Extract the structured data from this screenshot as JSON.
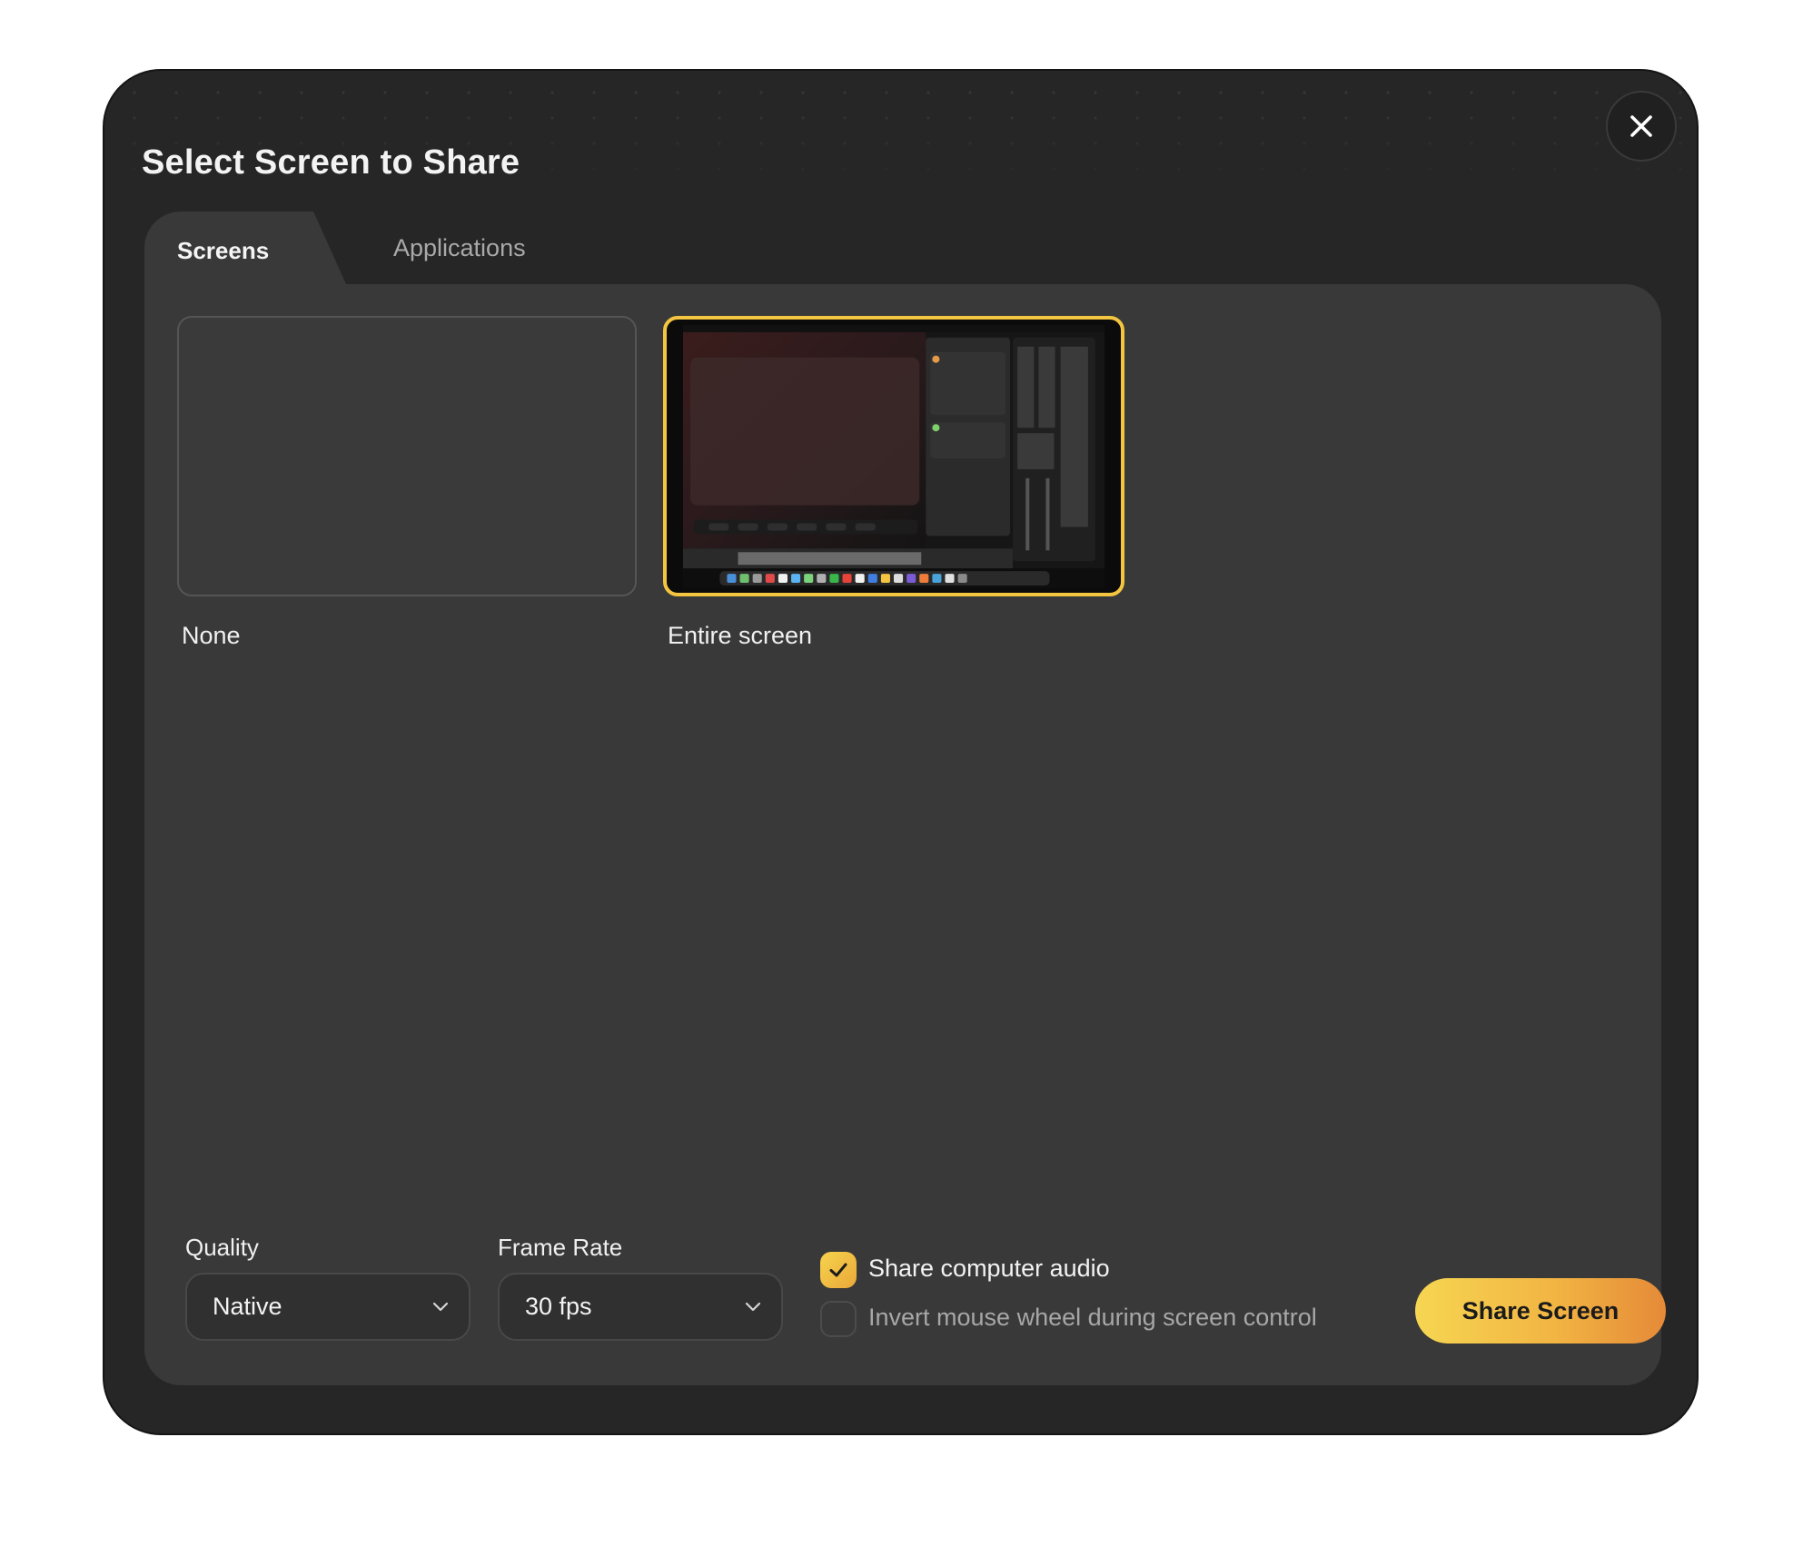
{
  "dialog": {
    "title": "Select Screen to Share",
    "close_icon": "close-icon"
  },
  "tabs": [
    {
      "label": "Screens",
      "active": true
    },
    {
      "label": "Applications",
      "active": false
    }
  ],
  "sources": [
    {
      "label": "None",
      "selected": false
    },
    {
      "label": "Entire screen",
      "selected": true
    }
  ],
  "quality": {
    "label": "Quality",
    "value": "Native"
  },
  "frame_rate": {
    "label": "Frame Rate",
    "value": "30 fps"
  },
  "options": {
    "share_audio": {
      "label": "Share computer audio",
      "checked": true
    },
    "invert_wheel": {
      "label": "Invert mouse wheel during screen control",
      "checked": false
    }
  },
  "share_button": {
    "label": "Share Screen"
  },
  "colors": {
    "accent": "#f3c540",
    "modal_bg": "#262626",
    "panel_bg": "#393939",
    "button_gradient_start": "#f6d652",
    "button_gradient_end": "#e58a38"
  }
}
